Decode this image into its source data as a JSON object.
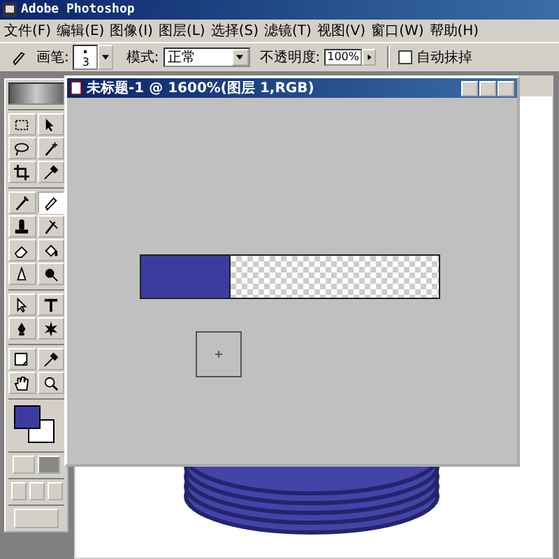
{
  "app_title": "Adobe Photoshop",
  "menu": [
    "文件(F)",
    "编辑(E)",
    "图像(I)",
    "图层(L)",
    "选择(S)",
    "滤镜(T)",
    "视图(V)",
    "窗口(W)",
    "帮助(H)"
  ],
  "options_bar": {
    "brush_label": "画笔:",
    "brush_size": "3",
    "mode_label": "模式:",
    "mode_value": "正常",
    "opacity_label": "不透明度:",
    "opacity_value": "100%",
    "auto_erase": {
      "label": "自动抹掉",
      "checked": false
    }
  },
  "toolbox": {
    "tools": [
      {
        "selected": false
      },
      {
        "selected": false
      },
      {
        "selected": false
      },
      {
        "selected": false
      },
      {
        "selected": false
      },
      {
        "selected": false
      },
      {
        "selected": false
      },
      {
        "selected": true
      },
      {
        "selected": false
      },
      {
        "selected": false
      },
      {
        "selected": false
      },
      {
        "selected": false
      },
      {
        "selected": false
      },
      {
        "selected": false
      },
      {
        "selected": false
      },
      {
        "selected": false
      },
      {
        "selected": false
      },
      {
        "selected": false
      },
      {
        "selected": false
      },
      {
        "selected": false
      },
      {
        "selected": false
      },
      {
        "selected": false
      }
    ]
  },
  "document": {
    "title": "未标题-1 @ 1600%(图层 1,RGB)"
  }
}
